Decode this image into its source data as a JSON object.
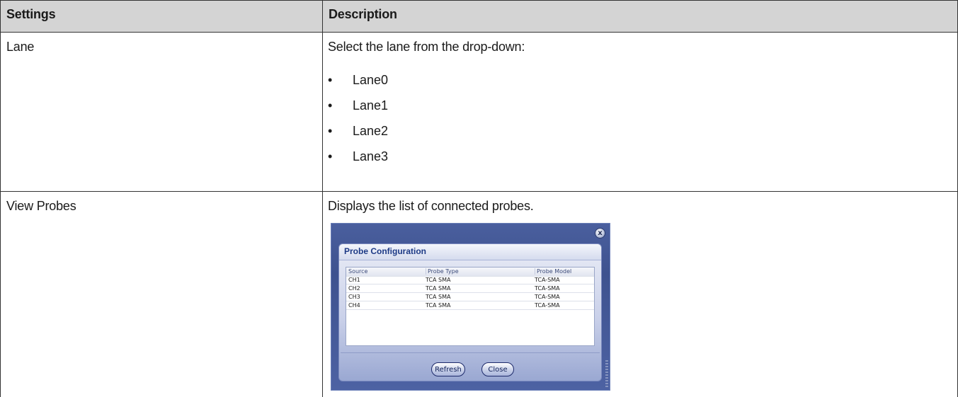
{
  "table": {
    "headers": [
      "Settings",
      "Description"
    ],
    "rows": [
      {
        "setting": "Lane",
        "description": "Select the lane from the drop-down:",
        "bullets": [
          "Lane0",
          "Lane1",
          "Lane2",
          "Lane3"
        ]
      },
      {
        "setting": "View Probes",
        "description": "Displays the list of connected probes."
      }
    ]
  },
  "dialog": {
    "title": "Probe Configuration",
    "close_glyph": "x",
    "columns": [
      "Source",
      "Probe Type",
      "Probe Model"
    ],
    "rows": [
      [
        "CH1",
        "TCA SMA",
        "TCA-SMA"
      ],
      [
        "CH2",
        "TCA SMA",
        "TCA-SMA"
      ],
      [
        "CH3",
        "TCA SMA",
        "TCA-SMA"
      ],
      [
        "CH4",
        "TCA SMA",
        "TCA-SMA"
      ]
    ],
    "buttons": {
      "refresh": "Refresh",
      "close": "Close"
    }
  },
  "bullet_glyph": "•"
}
